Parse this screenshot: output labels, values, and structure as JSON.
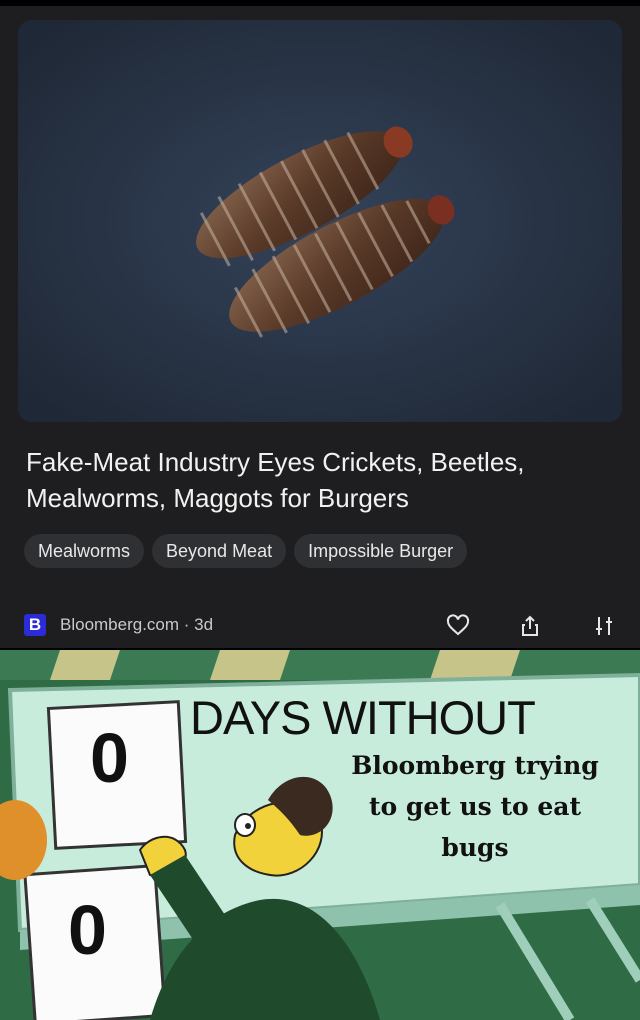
{
  "article": {
    "headline": "Fake-Meat Industry Eyes Crickets, Beetles, Mealworms, Maggots for Burgers",
    "tags": [
      "Mealworms",
      "Beyond Meat",
      "Impossible Burger"
    ],
    "source_logo": "B",
    "source": "Bloomberg.com · 3d",
    "actions": [
      "heart-icon",
      "share-icon",
      "filter-icon"
    ]
  },
  "meme": {
    "counter_top": "0",
    "counter_bottom": "0",
    "sign_title": "DAYS WITHOUT",
    "caption_line1": "Bloomberg trying",
    "caption_line2": "to get us to eat",
    "caption_line3": "bugs"
  },
  "colors": {
    "card_bg": "#1e1e20",
    "chip_bg": "#2e3033",
    "logo": "#2b2bd8",
    "hero_bg": "#2a3545"
  }
}
